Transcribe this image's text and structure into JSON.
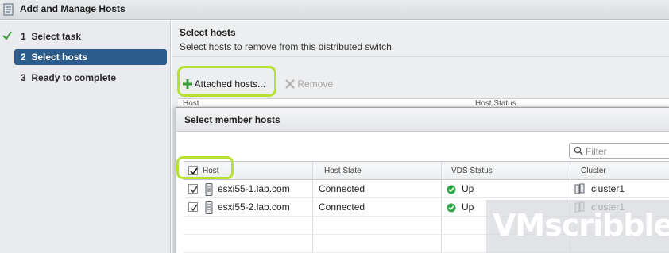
{
  "window": {
    "title": "Add and Manage Hosts",
    "icon": "wizard-icon"
  },
  "nav": {
    "steps": [
      {
        "number": "1",
        "label": "Select task",
        "status": "completed"
      },
      {
        "number": "2",
        "label": "Select hosts",
        "status": "active"
      },
      {
        "number": "3",
        "label": "Ready to complete",
        "status": "pending"
      }
    ]
  },
  "main": {
    "title": "Select hosts",
    "subtitle": "Select hosts to remove from this distributed switch.",
    "toolbar": {
      "attached_label": "Attached hosts...",
      "remove_label": "Remove"
    },
    "bg_columns": [
      "Host",
      "Host Status"
    ]
  },
  "dialog": {
    "title": "Select member hosts",
    "filter_placeholder": "Filter",
    "columns": [
      "Host",
      "Host State",
      "VDS Status",
      "Cluster"
    ],
    "rows": [
      {
        "host": "esxi55-1.lab.com",
        "state": "Connected",
        "vds": "Up",
        "cluster": "cluster1",
        "checked": true
      },
      {
        "host": "esxi55-2.lab.com",
        "state": "Connected",
        "vds": "Up",
        "cluster": "cluster1",
        "checked": true
      }
    ]
  },
  "watermark": "VMscribble",
  "colors": {
    "highlight": "#b7e035",
    "active_step": "#2b5c8a",
    "status_up": "#2fa94a"
  }
}
